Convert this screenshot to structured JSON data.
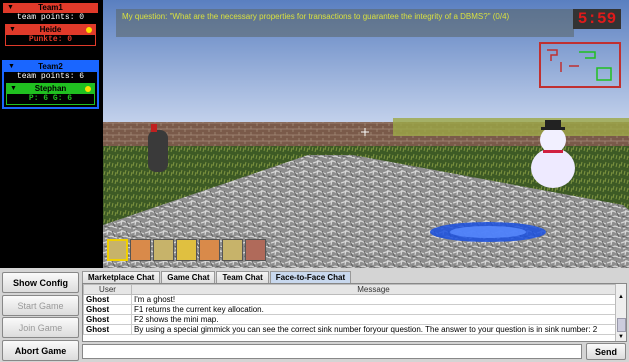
{
  "teams": [
    {
      "name": "Team1",
      "points": "team points: 0",
      "color": "#e03a2a",
      "members": [
        {
          "name": "Heide",
          "stats": "Punkte: 0",
          "color": "#e03a2a"
        }
      ]
    },
    {
      "name": "Team2",
      "points": "team points: 6",
      "color": "#1a66ff",
      "members": [
        {
          "name": "Stephan",
          "stats": "P: 6  G: 6",
          "color": "#20c020"
        }
      ]
    }
  ],
  "hud": {
    "question": "My question: \"What are the necessary properties for transactions to guarantee the integrity of a DBMS?\" (0/4)",
    "counter": "5:59"
  },
  "buttons": {
    "show_config": "Show Config",
    "start_game": "Start Game",
    "join_game": "Join Game",
    "abort_game": "Abort Game",
    "send": "Send"
  },
  "chat": {
    "tabs": [
      "Marketplace Chat",
      "Game Chat",
      "Team Chat",
      "Face-to-Face Chat"
    ],
    "active_tab": 3,
    "columns": [
      "User",
      "Message"
    ],
    "rows": [
      {
        "user": "Ghost",
        "message": "I'm a ghost!"
      },
      {
        "user": "Ghost",
        "message": "F1 returns the current key allocation."
      },
      {
        "user": "Ghost",
        "message": "F2 shows the mini map."
      },
      {
        "user": "Ghost",
        "message": "By using a special gimmick you can see the correct sink number foryour question. The answer to your question is in sink number: 2"
      }
    ],
    "input_value": ""
  },
  "icons": {
    "chevron": "chevron-down-icon",
    "status": "status-dot-icon",
    "scroll_up": "scroll-up-icon",
    "scroll_down": "scroll-down-icon"
  }
}
